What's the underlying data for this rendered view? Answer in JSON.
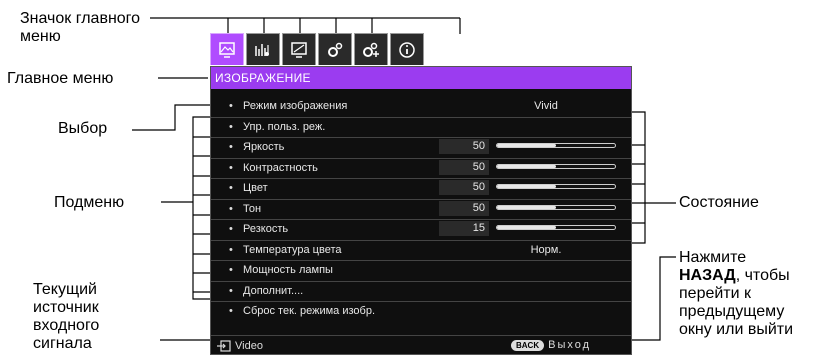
{
  "annotations": {
    "main_menu_icon": "Значок главного меню",
    "main_menu": "Главное меню",
    "selection": "Выбор",
    "submenu": "Подменю",
    "current_source": "Текущий источник входного сигнала",
    "status": "Состояние",
    "back_prefix": "Нажмите",
    "back_key": "НАЗАД",
    "back_suffix": ", чтобы перейти к предыдущему окну или выйти"
  },
  "osd": {
    "tabs": [
      "picture-icon",
      "audio-icon",
      "display-icon",
      "settings-icon",
      "advanced-settings-icon",
      "info-icon"
    ],
    "active_tab": 0,
    "header": "ИЗОБРАЖЕНИЕ",
    "items": [
      {
        "label": "Режим изображения",
        "value": "Vivid"
      },
      {
        "label": "Упр. польз. реж."
      },
      {
        "label": "Яркость",
        "number": "50",
        "level": 0.5
      },
      {
        "label": "Контрастность",
        "number": "50",
        "level": 0.5
      },
      {
        "label": "Цвет",
        "number": "50",
        "level": 0.5
      },
      {
        "label": "Тон",
        "number": "50",
        "level": 0.5
      },
      {
        "label": "Резкость",
        "number": "15",
        "level": 0.5
      },
      {
        "label": "Температура цвета",
        "value": "Норм."
      },
      {
        "label": "Мощность лампы"
      },
      {
        "label": "Дополнит...."
      },
      {
        "label": "Сброс тек. режима изобр."
      }
    ],
    "footer": {
      "source": "Video",
      "back_button": "BACK",
      "exit_label": "Выход"
    }
  }
}
